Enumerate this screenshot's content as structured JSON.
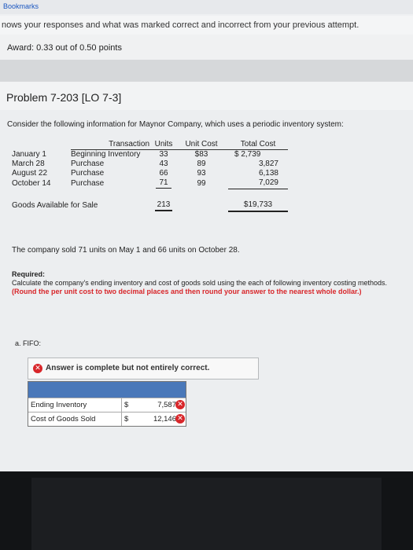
{
  "browser": {
    "bookmarks_label": "Bookmarks"
  },
  "header": {
    "notice": "nows your responses and what was marked correct and incorrect from your previous attempt.",
    "award": "Award: 0.33 out of 0.50 points"
  },
  "problem": {
    "title": "Problem 7-203 [LO 7-3]",
    "intro": "Consider the following information for Maynor Company, which uses a periodic inventory system:",
    "table": {
      "headers": {
        "transaction": "Transaction",
        "units": "Units",
        "unit_cost": "Unit Cost",
        "total_cost": "Total Cost"
      },
      "rows": [
        {
          "date": "January 1",
          "transaction": "Beginning Inventory",
          "units": "33",
          "unit_cost": "$83",
          "total_cost": "$ 2,739"
        },
        {
          "date": "March 28",
          "transaction": "Purchase",
          "units": "43",
          "unit_cost": "89",
          "total_cost": "3,827"
        },
        {
          "date": "August 22",
          "transaction": "Purchase",
          "units": "66",
          "unit_cost": "93",
          "total_cost": "6,138"
        },
        {
          "date": "October 14",
          "transaction": "Purchase",
          "units": "71",
          "unit_cost": "99",
          "total_cost": "7,029"
        }
      ],
      "footer": {
        "label": "Goods Available for Sale",
        "units": "213",
        "total_cost": "$19,733"
      }
    },
    "sold_text": "The company sold 71 units on May 1 and 66 units on October 28.",
    "required_label": "Required:",
    "required_text": "Calculate the company's ending inventory and cost of goods sold using the each of following inventory costing methods.",
    "required_red": "(Round the per unit cost to two decimal places and then round your answer to the nearest whole dollar.)",
    "part_label": "a. FIFO:"
  },
  "answer": {
    "status": "Answer is complete but not entirely correct.",
    "rows": [
      {
        "label": "Ending Inventory",
        "currency": "$",
        "value": "7,587"
      },
      {
        "label": "Cost of Goods Sold",
        "currency": "$",
        "value": "12,146"
      }
    ],
    "status_color": "#d8262a",
    "header_color": "#4a78b9"
  },
  "icons": {
    "wrong": "x-circle-icon",
    "status": "x-circle-icon"
  }
}
